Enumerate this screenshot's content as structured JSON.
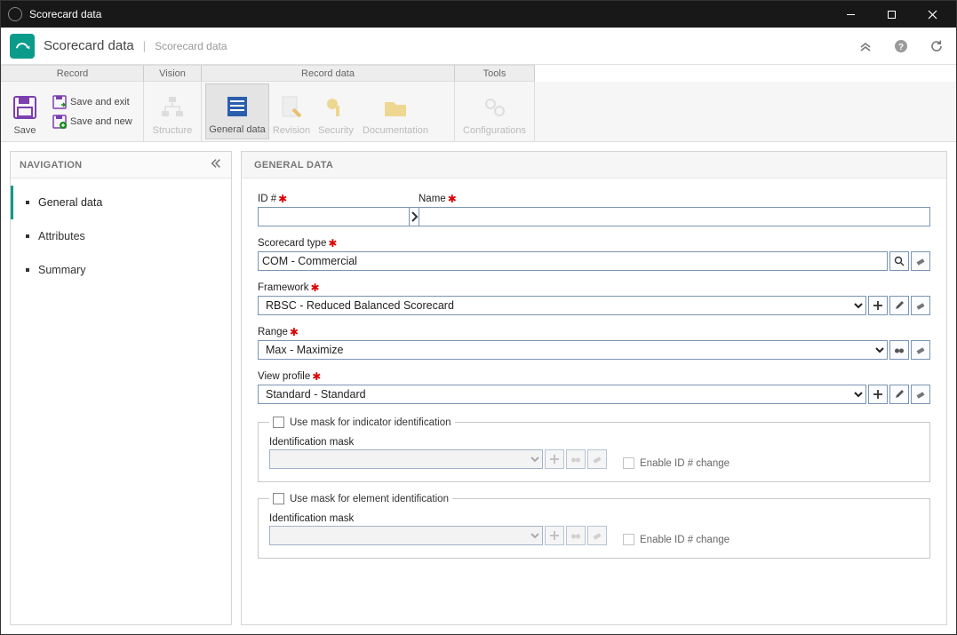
{
  "titlebar": {
    "title": "Scorecard data"
  },
  "header": {
    "title": "Scorecard data",
    "breadcrumb": "Scorecard data"
  },
  "ribbon": {
    "tabs": {
      "record": "Record",
      "vision": "Vision",
      "record_data": "Record data",
      "tools": "Tools"
    },
    "save": "Save",
    "save_exit": "Save and exit",
    "save_new": "Save and new",
    "structure": "Structure",
    "general_data": "General data",
    "revision": "Revision",
    "security": "Security",
    "documentation": "Documentation",
    "configurations": "Configurations"
  },
  "nav": {
    "heading": "NAVIGATION",
    "items": {
      "general_data": "General data",
      "attributes": "Attributes",
      "summary": "Summary"
    }
  },
  "content": {
    "heading": "GENERAL DATA",
    "labels": {
      "id": "ID #",
      "name": "Name",
      "scorecard_type": "Scorecard type",
      "framework": "Framework",
      "range": "Range",
      "view_profile": "View profile",
      "mask_indicator": "Use mask for indicator identification",
      "mask_element": "Use mask for element identification",
      "identification_mask": "Identification mask",
      "enable_id_change": "Enable ID # change"
    },
    "values": {
      "id": "",
      "name": "",
      "scorecard_type": "COM - Commercial",
      "framework": "RBSC - Reduced Balanced Scorecard",
      "range": "Max - Maximize",
      "view_profile": "Standard - Standard"
    }
  }
}
